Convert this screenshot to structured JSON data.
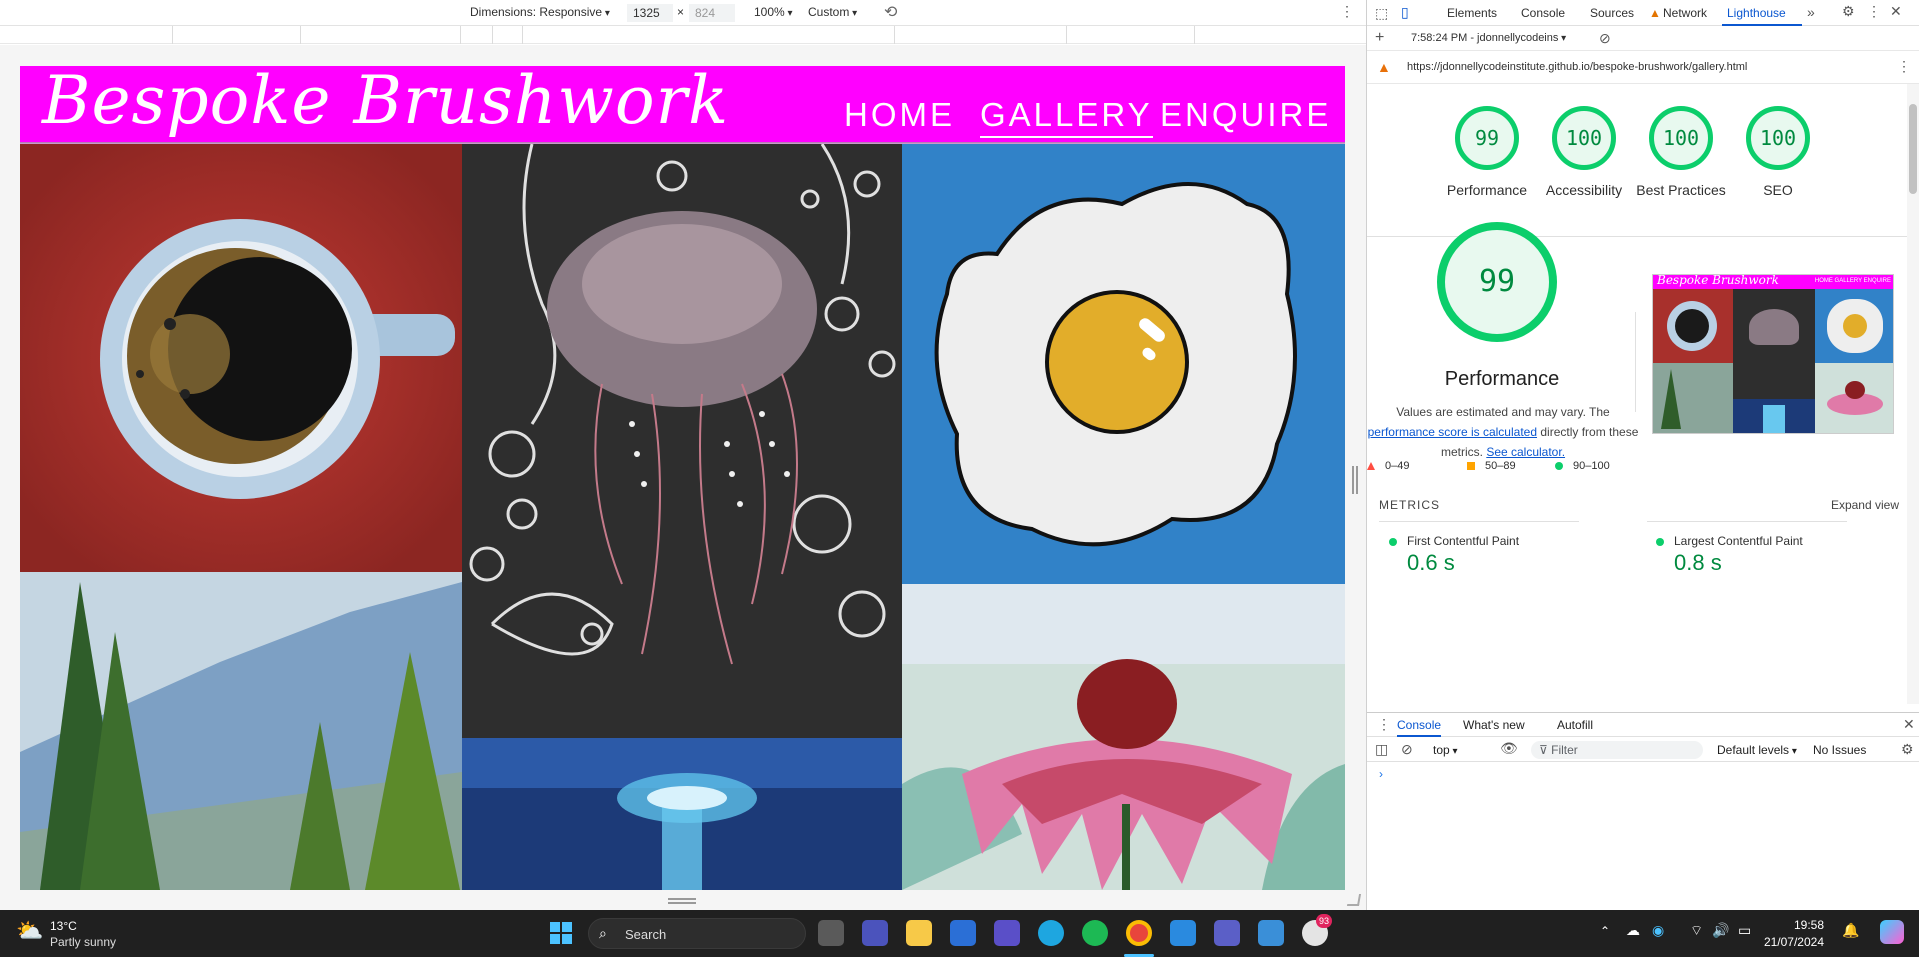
{
  "device_toolbar": {
    "dimensions_label": "Dimensions: Responsive",
    "width": "1325",
    "separator": "×",
    "height": "824",
    "zoom": "100%",
    "throttle": "Custom"
  },
  "site": {
    "logo": "Bespoke Brushwork",
    "nav": [
      "HOME",
      "GALLERY",
      "ENQUIRE"
    ],
    "active_nav": "GALLERY"
  },
  "devtools": {
    "tabs": [
      "Elements",
      "Console",
      "Sources",
      "Network",
      "Lighthouse"
    ],
    "active_tab": "Lighthouse",
    "report_select": "7:58:24 PM - jdonnellycodeins",
    "url": "https://jdonnellycodeinstitute.github.io/bespoke-brushwork/gallery.html",
    "scores": [
      {
        "label": "Performance",
        "value": "99"
      },
      {
        "label": "Accessibility",
        "value": "100"
      },
      {
        "label": "Best Practices",
        "value": "100"
      },
      {
        "label": "SEO",
        "value": "100"
      }
    ],
    "big_score": "99",
    "perf_title": "Performance",
    "perf_desc_1": "Values are estimated and may vary. The",
    "perf_desc_link1": "performance score is calculated",
    "perf_desc_2": "directly from these metrics.",
    "perf_desc_link2": "See calculator.",
    "legend": [
      "0–49",
      "50–89",
      "90–100"
    ],
    "metrics_header": "METRICS",
    "expand_view": "Expand view",
    "metrics": [
      {
        "label": "First Contentful Paint",
        "value": "0.6 s"
      },
      {
        "label": "Largest Contentful Paint",
        "value": "0.8 s"
      }
    ],
    "thumb_logo": "Bespoke Brushwork",
    "thumb_nav": "HOME   GALLERY   ENQUIRE",
    "drawer_tabs": [
      "Console",
      "What's new",
      "Autofill"
    ],
    "console_context": "top",
    "filter_placeholder": "Filter",
    "default_levels": "Default levels",
    "no_issues": "No Issues",
    "prompt": "›"
  },
  "taskbar": {
    "temp": "13°C",
    "weather": "Partly sunny",
    "search": "Search",
    "time": "19:58",
    "date": "21/07/2024",
    "badge": "93"
  },
  "colors": {
    "header_magenta": "#ff00ff",
    "pass_green": "#0cce6b",
    "link_blue": "#0b57d0"
  }
}
